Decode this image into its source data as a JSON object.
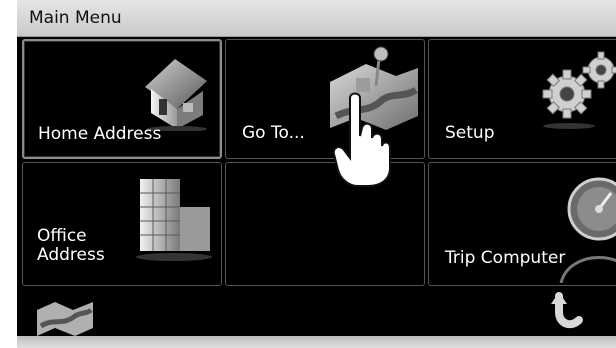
{
  "title": "Main Menu",
  "tiles": [
    {
      "label": "Home Address",
      "icon": "house-icon"
    },
    {
      "label": "Go To...",
      "icon": "map-pin-icon"
    },
    {
      "label": "Setup",
      "icon": "gears-icon"
    },
    {
      "label": "Office Address",
      "icon": "office-building-icon"
    },
    {
      "label": "",
      "icon": ""
    },
    {
      "label": "Trip Computer",
      "icon": "speedometer-icon"
    }
  ],
  "bottom": {
    "left_icon": "map-icon",
    "right_icon": "back-arrow-icon"
  },
  "cursor_icon": "hand-pointer-icon"
}
